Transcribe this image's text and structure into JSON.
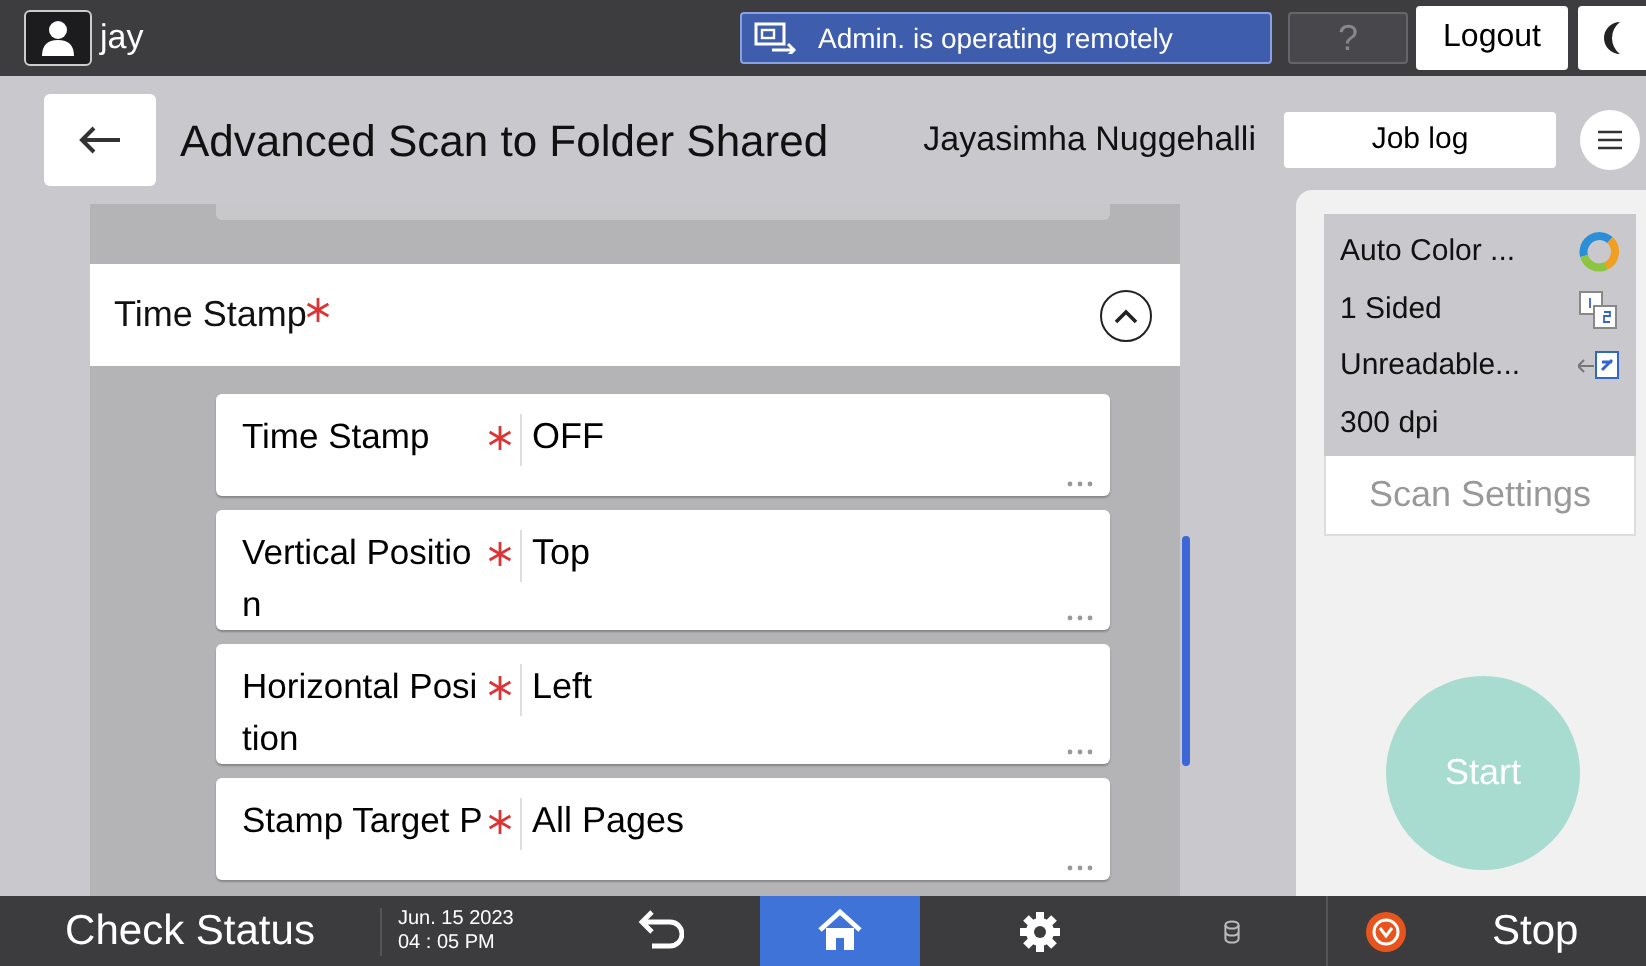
{
  "top_bar": {
    "user": "jay",
    "remote_banner": "Admin. is operating remotely",
    "help": "?",
    "logout": "Logout"
  },
  "header": {
    "title": "Advanced Scan to Folder Shared",
    "user_name": "Jayasimha Nuggehalli",
    "job_log": "Job log"
  },
  "section": {
    "title": "Time Stamp",
    "required": true,
    "expanded": true
  },
  "settings": [
    {
      "label": "Time Stamp",
      "required": true,
      "value": "OFF"
    },
    {
      "label": "Vertical Position",
      "required": true,
      "value": "Top"
    },
    {
      "label": "Horizontal Position",
      "required": true,
      "value": "Left"
    },
    {
      "label": "Stamp Target P",
      "required": true,
      "value": "All Pages"
    }
  ],
  "summary": [
    {
      "text": "Auto Color ...",
      "kind": "color"
    },
    {
      "text": "1 Sided",
      "kind": "sided"
    },
    {
      "text": "Unreadable...",
      "kind": "orientation"
    },
    {
      "text": "300 dpi",
      "kind": "plain"
    }
  ],
  "scan_settings": {
    "label": "Scan Settings",
    "disabled": true
  },
  "start": {
    "label": "Start",
    "disabled": true
  },
  "footer": {
    "check_status": "Check Status",
    "date": "Jun. 15 2023",
    "time": "04 : 05 PM",
    "nav": [
      {
        "kind": "back",
        "selected": false
      },
      {
        "kind": "home",
        "selected": true
      },
      {
        "kind": "settings",
        "selected": false
      }
    ],
    "stop": "Stop"
  }
}
